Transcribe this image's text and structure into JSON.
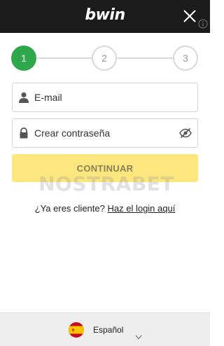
{
  "header": {
    "logo_text": "bwin",
    "close_icon": "close-icon",
    "info_icon": "info-icon"
  },
  "stepper": {
    "steps": [
      {
        "label": "1",
        "state": "active"
      },
      {
        "label": "2",
        "state": "inactive"
      },
      {
        "label": "3",
        "state": "inactive"
      }
    ],
    "colors": {
      "active": "#2ea84a",
      "inactive_border": "#d8d8d8"
    }
  },
  "form": {
    "email": {
      "placeholder": "E-mail",
      "value": "",
      "icon": "user-icon"
    },
    "password": {
      "placeholder": "Crear contraseña",
      "value": "",
      "icon": "lock-icon",
      "toggle_icon": "eye-slash-icon"
    },
    "submit_label": "CONTINUAR",
    "submit_color": "#fce77f"
  },
  "watermark": {
    "text": "NOSTRABET"
  },
  "login": {
    "prompt": "¿Ya eres cliente?",
    "link_text": "Haz el login aquí"
  },
  "footer": {
    "language": {
      "label": "Español",
      "flag_icon": "spain-flag-icon"
    }
  }
}
